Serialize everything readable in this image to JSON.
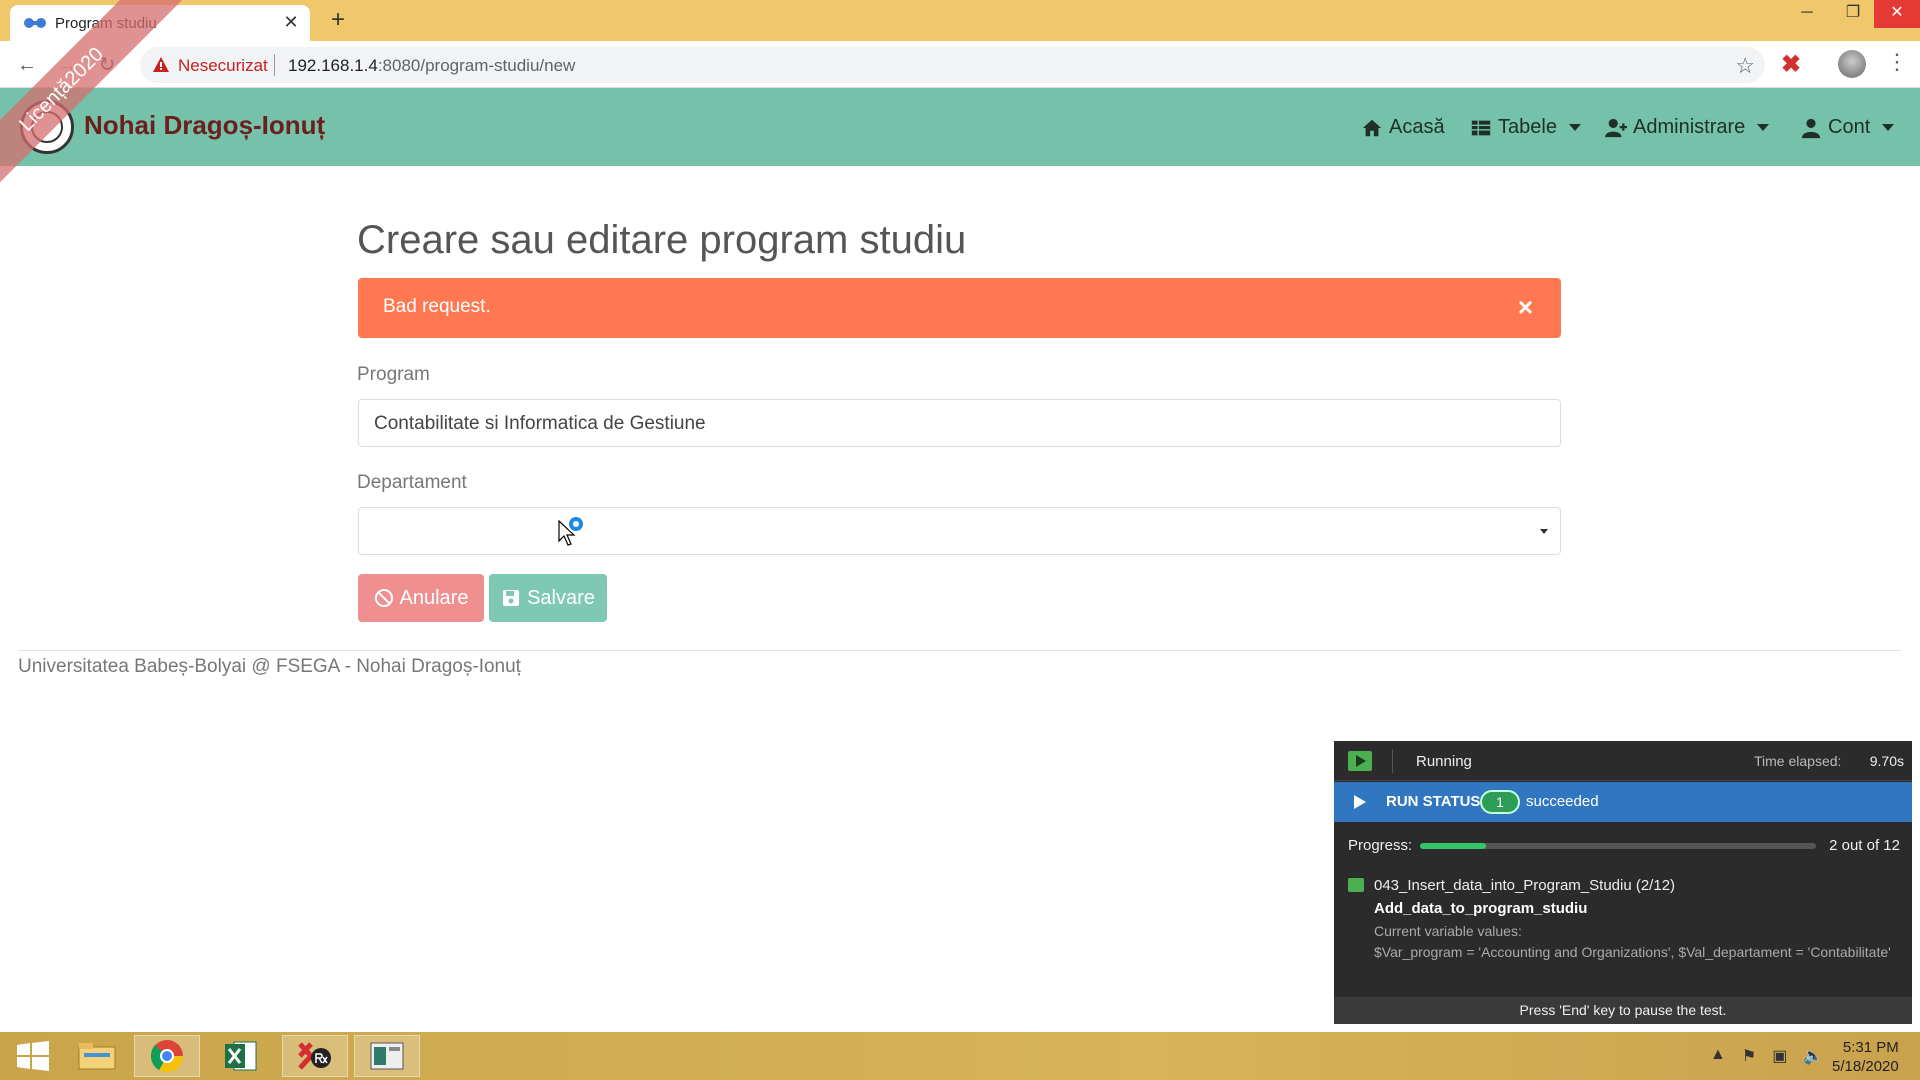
{
  "browser": {
    "tab_title": "Program studiu",
    "not_secure": "Nesecurizat",
    "url_host": "192.168.1.4",
    "url_rest": ":8080/program-studiu/new"
  },
  "app": {
    "brand": "Nohai Dragoș-Ionuț",
    "ribbon": "Licență2020",
    "nav": {
      "home": "Acasă",
      "tables": "Tabele",
      "admin": "Administrare",
      "account": "Cont"
    }
  },
  "form": {
    "title": "Creare sau editare program studiu",
    "alert": "Bad request.",
    "program_label": "Program",
    "program_value": "Contabilitate si Informatica de Gestiune",
    "department_label": "Departament",
    "department_value": "",
    "cancel": "Anulare",
    "save": "Salvare"
  },
  "footer": "Universitatea Babeș-Bolyai @ FSEGA - Nohai Dragoș-Ionuț",
  "ranorex": {
    "state": "Running",
    "elapsed_label": "Time elapsed:",
    "elapsed": "9.70s",
    "run_status": "RUN STATUS",
    "succeeded_count": "1",
    "succeeded": "succeeded",
    "progress_label": "Progress:",
    "progress_fraction": 0.1667,
    "progress_text": "2 out of 12",
    "test_case": "043_Insert_data_into_Program_Studiu (2/12)",
    "step": "Add_data_to_program_studiu",
    "vars_label": "Current variable values:",
    "vars": "$Var_program = 'Accounting and Organizations', $Val_departament = 'Contabilitate'",
    "footer": "Press 'End' key to pause the test."
  },
  "taskbar": {
    "time": "5:31 PM",
    "date": "5/18/2020"
  }
}
